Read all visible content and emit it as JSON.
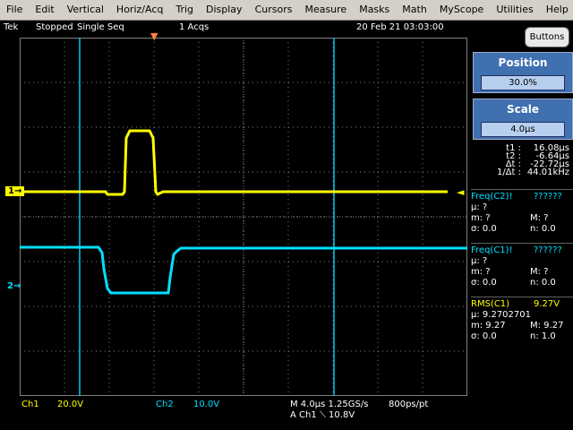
{
  "menu": [
    "File",
    "Edit",
    "Vertical",
    "Horiz/Acq",
    "Trig",
    "Display",
    "Cursors",
    "Measure",
    "Masks",
    "Math",
    "MyScope",
    "Utilities",
    "Help"
  ],
  "status": {
    "brand": "Tek",
    "state": "Stopped",
    "mode": "Single Seq",
    "acqs": "1 Acqs",
    "datetime": "20 Feb 21 03:03:00"
  },
  "buttons_label": "Buttons",
  "position": {
    "label": "Position",
    "value": "30.0%"
  },
  "scale": {
    "label": "Scale",
    "value": "4.0µs"
  },
  "cursor_readout": [
    {
      "name": "t1 :",
      "value": "16.08µs"
    },
    {
      "name": "t2 :",
      "value": "-6.64µs"
    },
    {
      "name": "Δt :",
      "value": "-22.72µs"
    },
    {
      "name": "1/Δt :",
      "value": "44.01kHz"
    }
  ],
  "measurements": [
    {
      "title": "Freq(C2)!",
      "value": "??????",
      "mu": "µ: ?",
      "m": "m: ?",
      "M": "M: ?",
      "sigma": "σ: 0.0",
      "n": "n: 0.0"
    },
    {
      "title": "Freq(C1)!",
      "value": "??????",
      "mu": "µ: ?",
      "m": "m: ?",
      "M": "M: ?",
      "sigma": "σ: 0.0",
      "n": "n: 0.0"
    },
    {
      "title": "RMS(C1)",
      "value": "9.27V",
      "mu": "µ: 9.2702701",
      "m": "m: 9.27",
      "M": "M: 9.27",
      "sigma": "σ: 0.0",
      "n": "n: 1.0"
    }
  ],
  "bottom": {
    "ch1_label": "Ch1",
    "ch1_scale": "20.0V",
    "ch2_label": "Ch2",
    "ch2_scale": "10.0V",
    "timebase": "M 4.0µs 1.25GS/s",
    "trigger": "A  Ch1  ⟍  10.8V",
    "record": "800ps/pt"
  },
  "markers": {
    "ch1": "1",
    "ch2": "2"
  },
  "colors": {
    "ch1": "#ffff00",
    "ch2": "#00e0ff",
    "cursor": "#00c8f0",
    "grid": "#808080",
    "measure_c2": "#00e0ff",
    "measure_c1": "#00e0ff",
    "measure_rms": "#ffff00",
    "panel": "#4070b0"
  },
  "cursors_us": {
    "t1": 16.08,
    "t2": -6.64
  }
}
